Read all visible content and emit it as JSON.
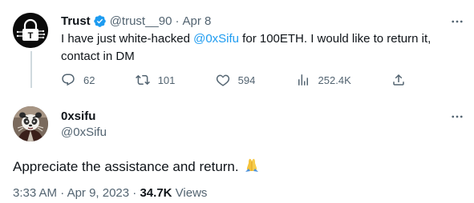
{
  "tweet1": {
    "author_name": "Trust",
    "handle": "@trust__90",
    "date": "Apr 8",
    "text_before": "I have just white-hacked ",
    "mention": "@0xSifu",
    "text_after": " for 100ETH. I would like to return it, contact in DM",
    "actions": {
      "replies": "62",
      "retweets": "101",
      "likes": "594",
      "views": "252.4K"
    }
  },
  "tweet2": {
    "author_name": "0xsifu",
    "handle": "@0xSifu",
    "text": "Appreciate the assistance and return.",
    "time": "3:33 AM",
    "date": "Apr 9, 2023",
    "views_count": "34.7K",
    "views_label": "Views"
  },
  "icons": {
    "verified": "verified-badge-icon",
    "reply": "reply-icon",
    "retweet": "retweet-icon",
    "like": "heart-icon",
    "views": "views-bar-chart-icon",
    "share": "share-icon",
    "more": "more-dots-icon",
    "emoji": "folded-hands-emoji"
  },
  "colors": {
    "accent": "#1d9bf0",
    "text": "#0f1419",
    "muted": "#536471",
    "thread_line": "#cfd9de"
  }
}
